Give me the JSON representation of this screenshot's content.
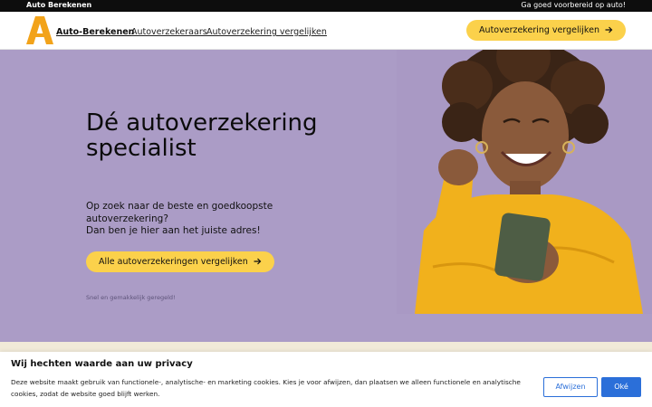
{
  "topbar": {
    "brand": "Auto Berekenen",
    "tagline": "Ga goed voorbereid op auto!"
  },
  "nav": {
    "logo_icon": "letter-a-logo",
    "site_name": "Auto-Berekenen",
    "links": [
      "Autoverzekeraars",
      "Autoverzekering vergelijken"
    ],
    "cta_label": "Autoverzekering vergelijken",
    "cta_icon": "arrow-right-icon"
  },
  "hero": {
    "title": "Dé autoverzekering specialist",
    "subtitle_line1": "Op zoek naar de beste en goedkoopste autoverzekering?",
    "subtitle_line2": "Dan ben je hier aan het juiste adres!",
    "cta_label": "Alle autoverzekeringen vergelijken",
    "note": "Snel en gemakkelijk geregeld!",
    "image_description": "woman in yellow sweater looking at phone",
    "background_color": "#ab9cc6"
  },
  "cookie_banner": {
    "title": "Wij hechten waarde aan uw privacy",
    "text": "Deze website maakt gebruik van functionele-, analytische- en marketing cookies. Kies je voor afwijzen, dan plaatsen we alleen functionele en analytische cookies, zodat de website goed blijft werken.",
    "decline_label": "Afwijzen",
    "accept_label": "Oké"
  },
  "colors": {
    "accent_yellow": "#fbd14b",
    "logo_orange": "#f2a31a",
    "button_blue": "#2b6fd9"
  }
}
